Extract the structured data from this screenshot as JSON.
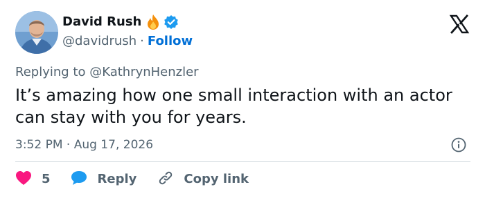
{
  "author": {
    "display_name": "David Rush",
    "handle": "@davidrush",
    "separator": "·",
    "follow_label": "Follow",
    "badges": [
      "fire-emoji",
      "verified-badge"
    ]
  },
  "header": {
    "logo_icon": "x-logo-icon"
  },
  "tweet": {
    "replying_to": "Replying to @KathrynHenzler",
    "text": "It’s amazing how one small interaction with an actor can stay with you for years.",
    "timestamp": "3:52 PM · Aug 17, 2026"
  },
  "actions": {
    "like_count": "5",
    "reply_label": "Reply",
    "copy_link_label": "Copy link"
  },
  "colors": {
    "link_blue": "#006fd6",
    "muted_gray": "#536471",
    "like_pink": "#f91880",
    "reply_blue": "#1d9bf0",
    "text": "#0f1419",
    "divider": "#cfd9de"
  }
}
